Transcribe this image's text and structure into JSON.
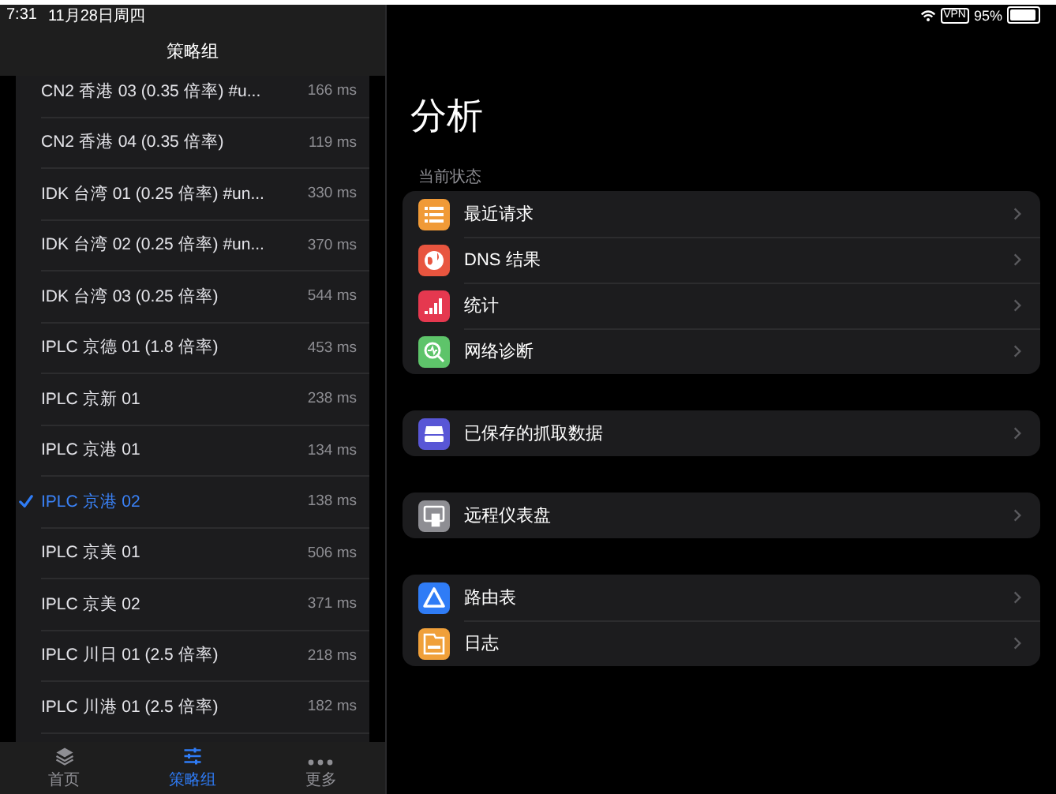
{
  "status_bar": {
    "time": "7:31",
    "date": "11月28日周四",
    "vpn": "VPN",
    "battery": {
      "text": "95%",
      "level": 0.95
    }
  },
  "sidebar": {
    "title": "策略组",
    "items": [
      {
        "name": "CN2 香港 03 (0.35 倍率) #u...",
        "latency": "166 ms",
        "selected": false
      },
      {
        "name": "CN2 香港 04 (0.35 倍率)",
        "latency": "119 ms",
        "selected": false
      },
      {
        "name": "IDK 台湾 01 (0.25 倍率) #un...",
        "latency": "330 ms",
        "selected": false
      },
      {
        "name": "IDK 台湾 02 (0.25 倍率) #un...",
        "latency": "370 ms",
        "selected": false
      },
      {
        "name": "IDK 台湾 03 (0.25 倍率)",
        "latency": "544 ms",
        "selected": false
      },
      {
        "name": "IPLC 京德 01 (1.8 倍率)",
        "latency": "453 ms",
        "selected": false
      },
      {
        "name": "IPLC 京新 01",
        "latency": "238 ms",
        "selected": false
      },
      {
        "name": "IPLC 京港 01",
        "latency": "134 ms",
        "selected": false
      },
      {
        "name": "IPLC 京港 02",
        "latency": "138 ms",
        "selected": true
      },
      {
        "name": "IPLC 京美 01",
        "latency": "506 ms",
        "selected": false
      },
      {
        "name": "IPLC 京美 02",
        "latency": "371 ms",
        "selected": false
      },
      {
        "name": "IPLC 川日 01 (2.5 倍率)",
        "latency": "218 ms",
        "selected": false
      },
      {
        "name": "IPLC 川港 01 (2.5 倍率)",
        "latency": "182 ms",
        "selected": false
      }
    ]
  },
  "tab_bar": [
    {
      "label": "首页",
      "kind": "layers",
      "selected": false
    },
    {
      "label": "策略组",
      "kind": "sliders",
      "selected": true
    },
    {
      "label": "更多",
      "kind": "more",
      "selected": false
    }
  ],
  "main": {
    "title": "分析",
    "groups": [
      {
        "header": "当前状态",
        "items": [
          {
            "label": "最近请求",
            "kind": "list",
            "color": "#f09a37"
          },
          {
            "label": "DNS 结果",
            "kind": "globe",
            "color": "#e8553f"
          },
          {
            "label": "统计",
            "kind": "chart",
            "color": "#e5384f"
          },
          {
            "label": "网络诊断",
            "kind": "search",
            "color": "#5ec46a"
          }
        ]
      },
      {
        "items": [
          {
            "label": "已保存的抓取数据",
            "kind": "tray",
            "color": "#5856d6"
          }
        ]
      },
      {
        "items": [
          {
            "label": "远程仪表盘",
            "kind": "monitor",
            "color": "#8e8e93"
          }
        ]
      },
      {
        "items": [
          {
            "label": "路由表",
            "kind": "triangle",
            "color": "#2f7cf6"
          },
          {
            "label": "日志",
            "kind": "folder",
            "color": "#f0a03a"
          }
        ]
      }
    ]
  }
}
